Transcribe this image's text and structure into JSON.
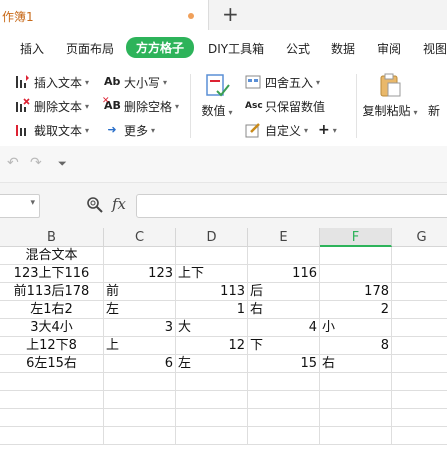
{
  "tab": {
    "title": "作簿1"
  },
  "menu": [
    "插入",
    "页面布局",
    "方方格子",
    "DIY工具箱",
    "公式",
    "数据",
    "审阅",
    "视图"
  ],
  "active_menu": "方方格子",
  "ribbon": {
    "col1": [
      "插入文本",
      "删除文本",
      "截取文本"
    ],
    "col2": [
      "大小写",
      "删除空格",
      "更多"
    ],
    "numeric": "数值",
    "col3": [
      "四舍五入",
      "只保留数值",
      "自定义"
    ],
    "copy_paste": "复制粘贴",
    "new_partial": "新"
  },
  "formula_bar": {
    "fx": "fx",
    "value": ""
  },
  "columns": [
    "B",
    "C",
    "D",
    "E",
    "F",
    "G"
  ],
  "selected_column": "F",
  "rows": [
    [
      "混合文本",
      "",
      "",
      "",
      "",
      ""
    ],
    [
      "123上下116",
      "123",
      "上下",
      "116",
      "",
      ""
    ],
    [
      "前113后178",
      "前",
      "113",
      "后",
      "178",
      ""
    ],
    [
      "左1右2",
      "左",
      "1",
      "右",
      "2",
      ""
    ],
    [
      "3大4小",
      "3",
      "大",
      "4",
      "小",
      ""
    ],
    [
      "上12下8",
      "上",
      "12",
      "下",
      "8",
      ""
    ],
    [
      "6左15右",
      "6",
      "左",
      "15",
      "右",
      ""
    ],
    [
      "",
      "",
      "",
      "",
      "",
      ""
    ],
    [
      "",
      "",
      "",
      "",
      "",
      ""
    ],
    [
      "",
      "",
      "",
      "",
      "",
      ""
    ],
    [
      "",
      "",
      "",
      "",
      "",
      ""
    ]
  ]
}
